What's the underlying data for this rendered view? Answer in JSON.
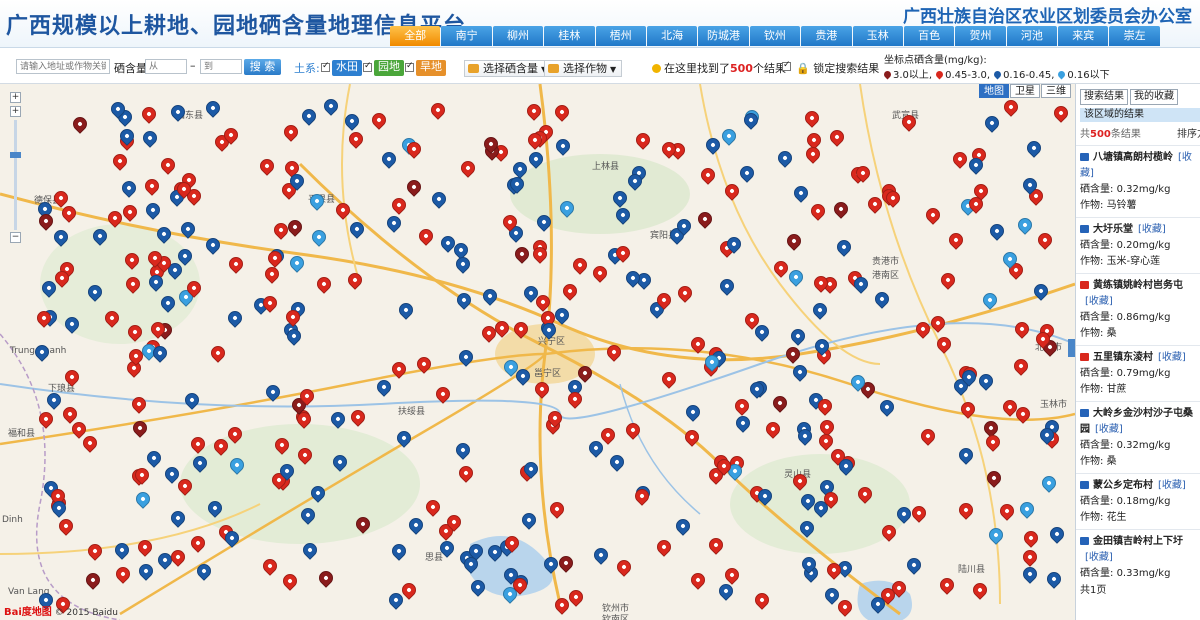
{
  "header": {
    "site_title": "广西规模以上耕地、园地硒含量地理信息平台",
    "office_title": "广西壮族自治区农业区划委员会办公室",
    "city_tabs": [
      "全部",
      "南宁",
      "柳州",
      "桂林",
      "梧州",
      "北海",
      "防城港",
      "钦州",
      "贵港",
      "玉林",
      "百色",
      "贺州",
      "河池",
      "来宾",
      "崇左"
    ],
    "active_tab": "全部",
    "active_color": "#f39800",
    "tab_color": "#2f86d6"
  },
  "toolbar": {
    "search_placeholder": "请输入地址或作物关键字",
    "selenium_label": "硒含量",
    "from_placeholder": "从",
    "range_sep": "–",
    "to_placeholder": "到",
    "search_button": "搜 索",
    "soil_label": "土系:",
    "soil_types": [
      {
        "label": "水田",
        "color": "#2d7fd0",
        "checked": true
      },
      {
        "label": "园地",
        "color": "#4aa63a",
        "checked": true
      },
      {
        "label": "旱地",
        "color": "#e6902a",
        "checked": true
      }
    ],
    "select_selenium": "选择硒含量",
    "select_crop": "选择作物",
    "found_prefix": "在这里找到了",
    "found_count": "500",
    "found_suffix": "个结果",
    "lock_search": "锁定搜索结果",
    "legend_title": "坐标点硒含量(mg/kg):",
    "legend": [
      {
        "label": "3.0以上,",
        "color": "#8a1c1c"
      },
      {
        "label": "0.45-3.0,",
        "color": "#d9281d"
      },
      {
        "label": "0.16-0.45,",
        "color": "#1c5aa6"
      },
      {
        "label": "0.16以下",
        "color": "#3aa0e0"
      }
    ]
  },
  "map": {
    "map_types": [
      "地图",
      "卫星",
      "三维"
    ],
    "active_type": "地图",
    "copyright": "© 2015 Baidu",
    "logo_text": "Bai度地图",
    "places": [
      {
        "name": "上林县"
      },
      {
        "name": "宾阳县"
      },
      {
        "name": "武宣县"
      },
      {
        "name": "贵港市"
      },
      {
        "name": "港南区"
      },
      {
        "name": "兴宁区"
      },
      {
        "name": "邕宁区"
      },
      {
        "name": "扶绥县"
      },
      {
        "name": "灵山县"
      },
      {
        "name": "钦州市"
      },
      {
        "name": "钦南区"
      },
      {
        "name": "思县"
      },
      {
        "name": "平果县"
      },
      {
        "name": "德保县"
      },
      {
        "name": "田东县"
      },
      {
        "name": "Trung Khanh"
      },
      {
        "name": "下琅县"
      },
      {
        "name": "福和县"
      },
      {
        "name": "Dinh"
      },
      {
        "name": "Van Lang"
      },
      {
        "name": "陆川县"
      },
      {
        "name": "北流市"
      },
      {
        "name": "玉林市"
      }
    ]
  },
  "panel": {
    "tabs": [
      "搜索结果",
      "我的收藏"
    ],
    "region_label": "该区域的结果",
    "count_prefix": "共",
    "count": "500",
    "count_suffix": "条结果",
    "sort_label": "排序方",
    "fav_label": "[收藏]",
    "selenium_key": "硒含量:",
    "crop_key": "作物:",
    "results": [
      {
        "name": "八塘镇高朗村榄岭",
        "selenium": "0.32mg/kg",
        "crop": "马铃薯",
        "flag": "blue"
      },
      {
        "name": "大圩乐堂",
        "selenium": "0.20mg/kg",
        "crop": "玉米-穿心莲",
        "flag": "blue"
      },
      {
        "name": "黄练镇姚岭村岜务屯",
        "selenium": "0.86mg/kg",
        "crop": "桑",
        "flag": "red"
      },
      {
        "name": "五里镇东淩村",
        "selenium": "0.79mg/kg",
        "crop": "甘蔗",
        "flag": "red"
      },
      {
        "name": "大岭乡金沙村沙子屯桑园",
        "selenium": "0.32mg/kg",
        "crop": "桑",
        "flag": "blue"
      },
      {
        "name": "蒙公乡定布村",
        "selenium": "0.18mg/kg",
        "crop": "花生",
        "flag": "blue"
      },
      {
        "name": "金田镇吉岭村上下圩",
        "selenium": "0.33mg/kg",
        "crop": "",
        "flag": "blue"
      }
    ],
    "page_count": "共1页"
  }
}
